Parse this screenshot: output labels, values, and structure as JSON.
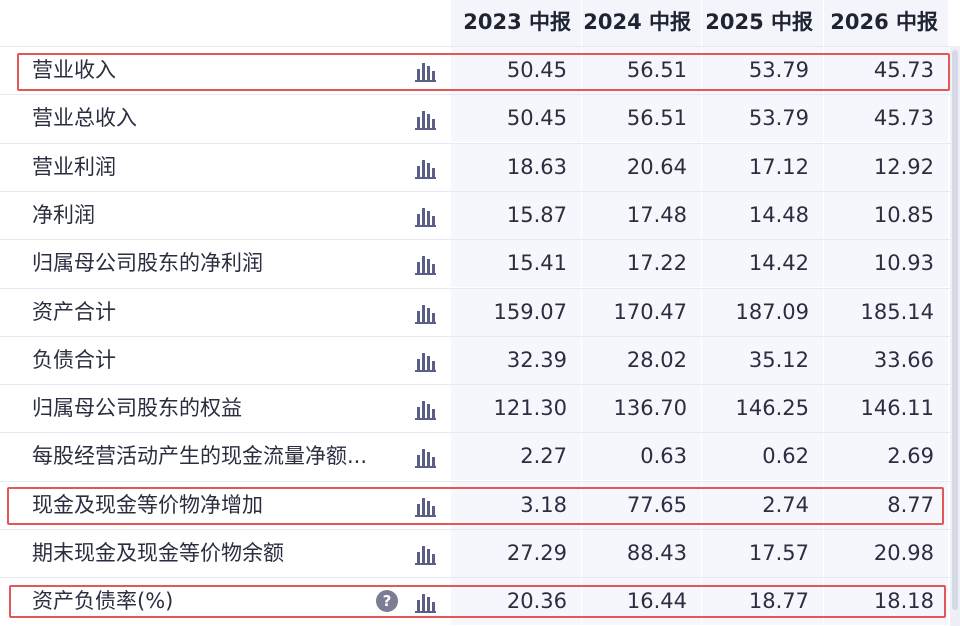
{
  "columns": [
    "2023 中报",
    "2024 中报",
    "2025 中报",
    "2026 中报"
  ],
  "rows": [
    {
      "label": "营业收入",
      "values": [
        "50.45",
        "56.51",
        "53.79",
        "45.73"
      ]
    },
    {
      "label": "营业总收入",
      "values": [
        "50.45",
        "56.51",
        "53.79",
        "45.73"
      ]
    },
    {
      "label": "营业利润",
      "values": [
        "18.63",
        "20.64",
        "17.12",
        "12.92"
      ]
    },
    {
      "label": "净利润",
      "values": [
        "15.87",
        "17.48",
        "14.48",
        "10.85"
      ]
    },
    {
      "label": "归属母公司股东的净利润",
      "values": [
        "15.41",
        "17.22",
        "14.42",
        "10.93"
      ]
    },
    {
      "label": "资产合计",
      "values": [
        "159.07",
        "170.47",
        "187.09",
        "185.14"
      ]
    },
    {
      "label": "负债合计",
      "values": [
        "32.39",
        "28.02",
        "35.12",
        "33.66"
      ]
    },
    {
      "label": "归属母公司股东的权益",
      "values": [
        "121.30",
        "136.70",
        "146.25",
        "146.11"
      ]
    },
    {
      "label": "每股经营活动产生的现金流量净额...",
      "values": [
        "2.27",
        "0.63",
        "0.62",
        "2.69"
      ]
    },
    {
      "label": "现金及现金等价物净增加",
      "values": [
        "3.18",
        "77.65",
        "2.74",
        "8.77"
      ]
    },
    {
      "label": "期末现金及现金等价物余额",
      "values": [
        "27.29",
        "88.43",
        "17.57",
        "20.98"
      ]
    },
    {
      "label": "资产负债率(%)",
      "values": [
        "20.36",
        "16.44",
        "18.77",
        "18.18"
      ]
    }
  ],
  "help_icon_text": "?",
  "colors": {
    "highlight": "#e45757",
    "header_bg": "#f4f5fb",
    "cell_bg": "#f6f7fc",
    "chart_icon": "#5b5f86"
  },
  "icons": {
    "row_chart": "bar-chart-icon",
    "help": "help-icon"
  }
}
